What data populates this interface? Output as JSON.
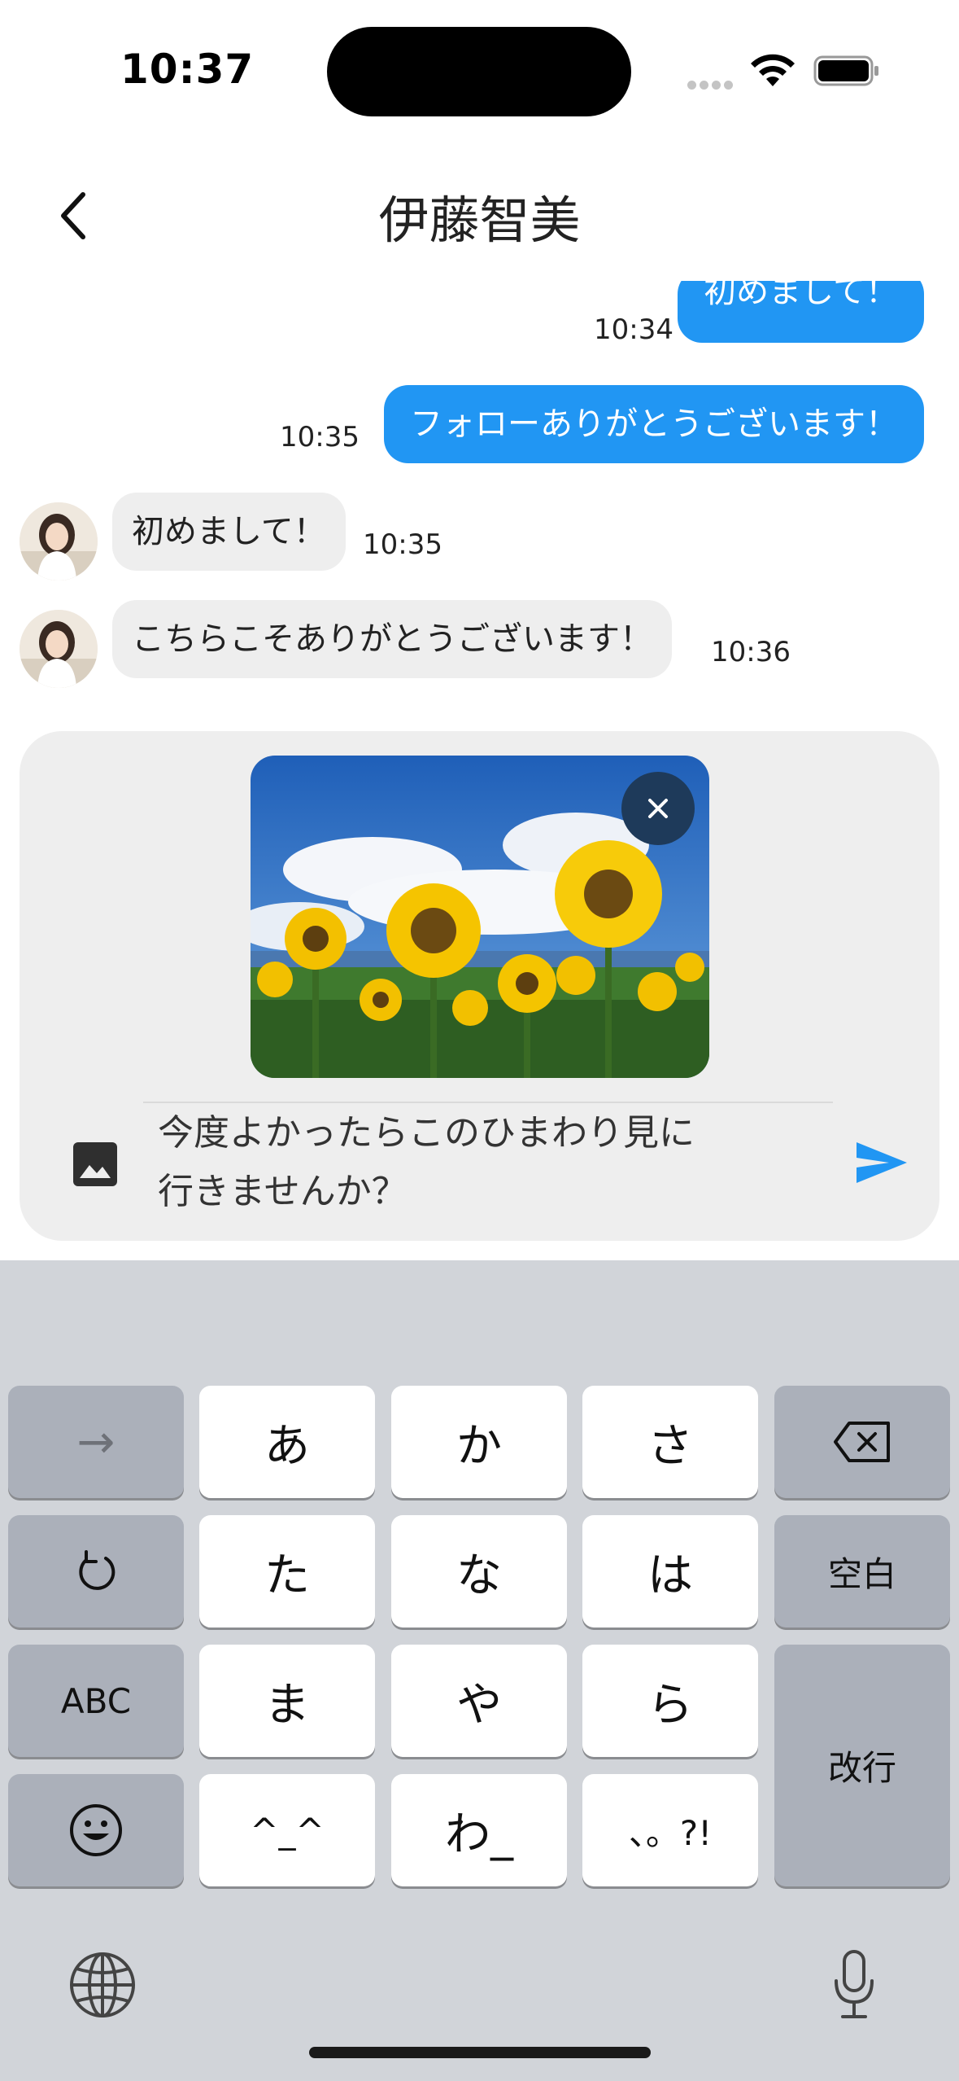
{
  "status_bar": {
    "time": "10:37"
  },
  "nav": {
    "title": "伊藤智美"
  },
  "messages": [
    {
      "direction": "out",
      "text": "初めまして！",
      "time": "10:34"
    },
    {
      "direction": "out",
      "text": "フォローありがとうございます！",
      "time": "10:35"
    },
    {
      "direction": "in",
      "text": "初めまして！",
      "time": "10:35"
    },
    {
      "direction": "in",
      "text": "こちらこそありがとうございます！",
      "time": "10:36"
    }
  ],
  "composer": {
    "text": "今度よかったらこのひまわり見に\n行きませんか？"
  },
  "keyboard": {
    "rows": [
      [
        "→",
        "あ",
        "か",
        "さ",
        "⌫"
      ],
      [
        "↺",
        "た",
        "な",
        "は",
        "空白"
      ],
      [
        "ABC",
        "ま",
        "や",
        "ら",
        "改行"
      ],
      [
        "☺",
        "^_^",
        "わ_",
        "、。?!"
      ]
    ]
  },
  "colors": {
    "accent": "#2196f3",
    "incoming_bubble": "#eeeeee",
    "keyboard_bg": "#d1d4d9",
    "key_light": "#ffffff",
    "key_dark": "#abb0ba"
  }
}
